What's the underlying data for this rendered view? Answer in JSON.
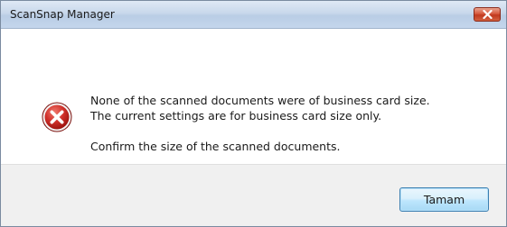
{
  "window": {
    "title": "ScanSnap Manager"
  },
  "dialog": {
    "icon": "error-icon",
    "message_lines": [
      "None of the scanned documents were of business card size.",
      "The current settings are for business card size only.",
      "Confirm the size of the scanned documents."
    ],
    "ok_label": "Tamam"
  },
  "colors": {
    "close_button": "#c9472a",
    "error_icon": "#d0302a",
    "ok_button_border": "#3c7fb1",
    "footer_background": "#f0f0f0"
  }
}
